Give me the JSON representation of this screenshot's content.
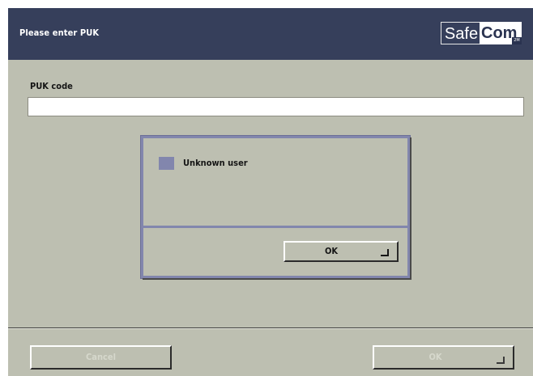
{
  "header": {
    "title": "Please enter PUK",
    "logo": {
      "part1": "Safe",
      "part2": "Com",
      "tag": "2M"
    }
  },
  "form": {
    "puk_label": "PUK code",
    "puk_value": ""
  },
  "dialog": {
    "message": "Unknown user",
    "ok_label": "OK",
    "icon": "status-square-icon",
    "icon_color": "#8286ad"
  },
  "footer": {
    "cancel_label": "Cancel",
    "ok_label": "OK"
  },
  "colors": {
    "header_bg": "#363f5b",
    "panel_bg": "#bdbfb1",
    "accent": "#8286ad"
  }
}
